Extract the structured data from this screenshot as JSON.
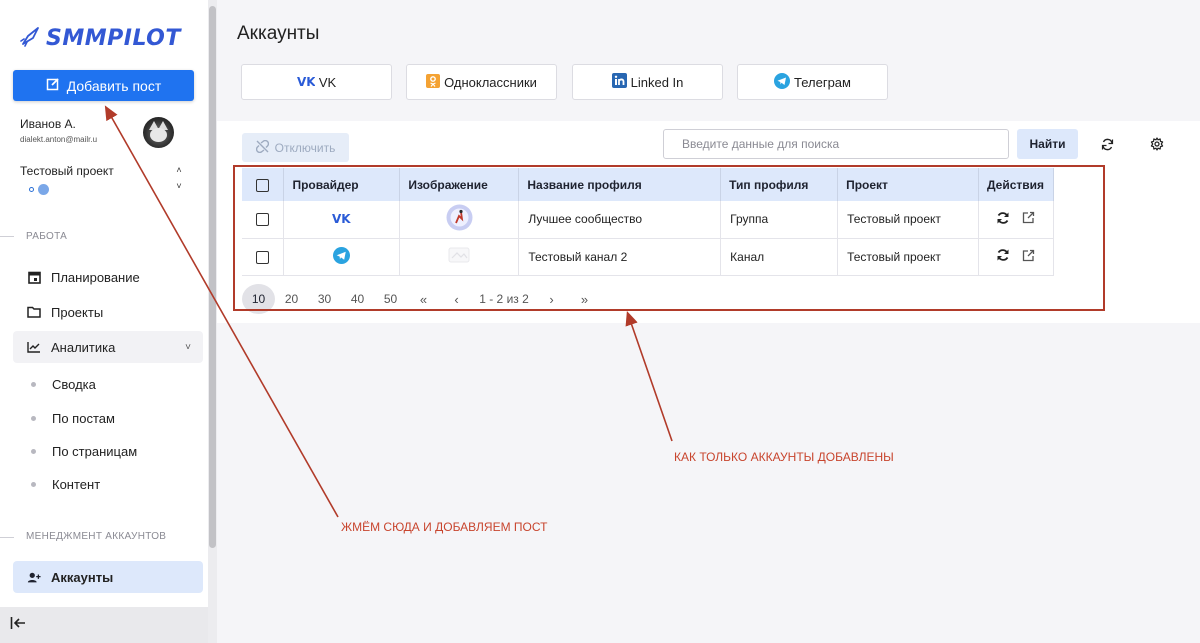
{
  "app": {
    "logo_text": "SMMPILOT",
    "brand_color": "#1f73f0",
    "accent_color": "#dde8fb",
    "annotation_color": "#c8452e"
  },
  "sidebar": {
    "add_post_label": "Добавить пост",
    "user_name": "Иванов А.",
    "user_email": "dialekt.anton@mailr.u",
    "project_select_value": "Тестовый проект",
    "sections": {
      "work": "РАБОТА",
      "account_management": "МЕНЕДЖМЕНТ АККАУНТОВ"
    },
    "nav": {
      "planning": "Планирование",
      "projects": "Проекты",
      "analytics": "Аналитика",
      "accounts": "Аккаунты"
    },
    "analytics_sub": [
      "Сводка",
      "По постам",
      "По страницам",
      "Контент"
    ]
  },
  "main": {
    "title": "Аккаунты",
    "provider_tabs": [
      {
        "label": "VK",
        "icon": "vk-icon"
      },
      {
        "label": "Одноклассники",
        "icon": "odnoklassniki-icon"
      },
      {
        "label": "Linked In",
        "icon": "linkedin-icon"
      },
      {
        "label": "Телеграм",
        "icon": "telegram-icon"
      }
    ],
    "toolbar": {
      "disconnect_label": "Отключить",
      "search_placeholder": "Введите данные для поиска",
      "find_label": "Найти"
    },
    "table": {
      "headers": [
        "Провайдер",
        "Изображение",
        "Название профиля",
        "Тип профиля",
        "Проект",
        "Действия"
      ],
      "rows": [
        {
          "provider_icon": "vk-icon",
          "image": "community-avatar",
          "profile_name": "Лучшее сообщество",
          "profile_type": "Группа",
          "project": "Тестовый проект"
        },
        {
          "provider_icon": "telegram-icon",
          "image": "channel-avatar",
          "profile_name": "Тестовый канал 2",
          "profile_type": "Канал",
          "project": "Тестовый проект"
        }
      ]
    },
    "pagination": {
      "page_sizes": [
        "10",
        "20",
        "30",
        "40",
        "50"
      ],
      "selected_page_size": "10",
      "first": "«",
      "prev": "‹",
      "range": "1 - 2 из 2",
      "next": "›",
      "last": "»"
    }
  },
  "annotations": {
    "add_post_note": "ЖМЁМ СЮДА И ДОБАВЛЯЕМ ПОСТ",
    "accounts_note": "КАК ТОЛЬКО АККАУНТЫ ДОБАВЛЕНЫ"
  }
}
